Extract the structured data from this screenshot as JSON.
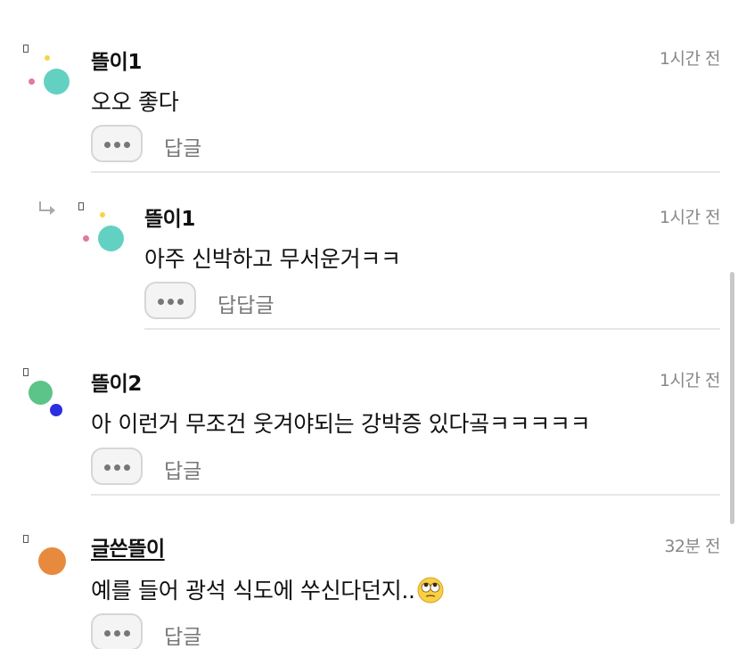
{
  "comments": [
    {
      "nickname": "뜰이1",
      "time": "1시간 전",
      "text": "오오 좋다",
      "reply_label": "답글",
      "avatar_colors": {
        "main": "#63d1c2",
        "accent1": "#f5d547",
        "accent2": "#e07aa0"
      }
    },
    {
      "nickname": "뜰이1",
      "time": "1시간 전",
      "text": "아주 신박하고 무서운거ㅋㅋ",
      "reply_label": "답답글",
      "is_reply": true,
      "avatar_colors": {
        "main": "#63d1c2",
        "accent1": "#f5d547",
        "accent2": "#e07aa0"
      }
    },
    {
      "nickname": "뜰이2",
      "time": "1시간 전",
      "text": "아 이런거 무조건 웃겨야되는 강박증 있다곸ㅋㅋㅋㅋㅋ",
      "reply_label": "답글",
      "avatar_colors": {
        "main": "#5cc488",
        "accent1": "#2a2ee0"
      }
    },
    {
      "nickname": "글쓴뜰이",
      "time": "32분 전",
      "text": "예를 들어 광석 식도에 쑤신다던지..",
      "emoji": "eye-roll-emoji",
      "reply_label": "답글",
      "is_author": true,
      "avatar_colors": {
        "main": "#e88a3e"
      }
    }
  ],
  "icons": {
    "more": "more-dots-icon",
    "reply_arrow": "reply-arrow-icon"
  },
  "colors": {
    "divider": "#e6e6e6",
    "muted_text": "#888888"
  }
}
